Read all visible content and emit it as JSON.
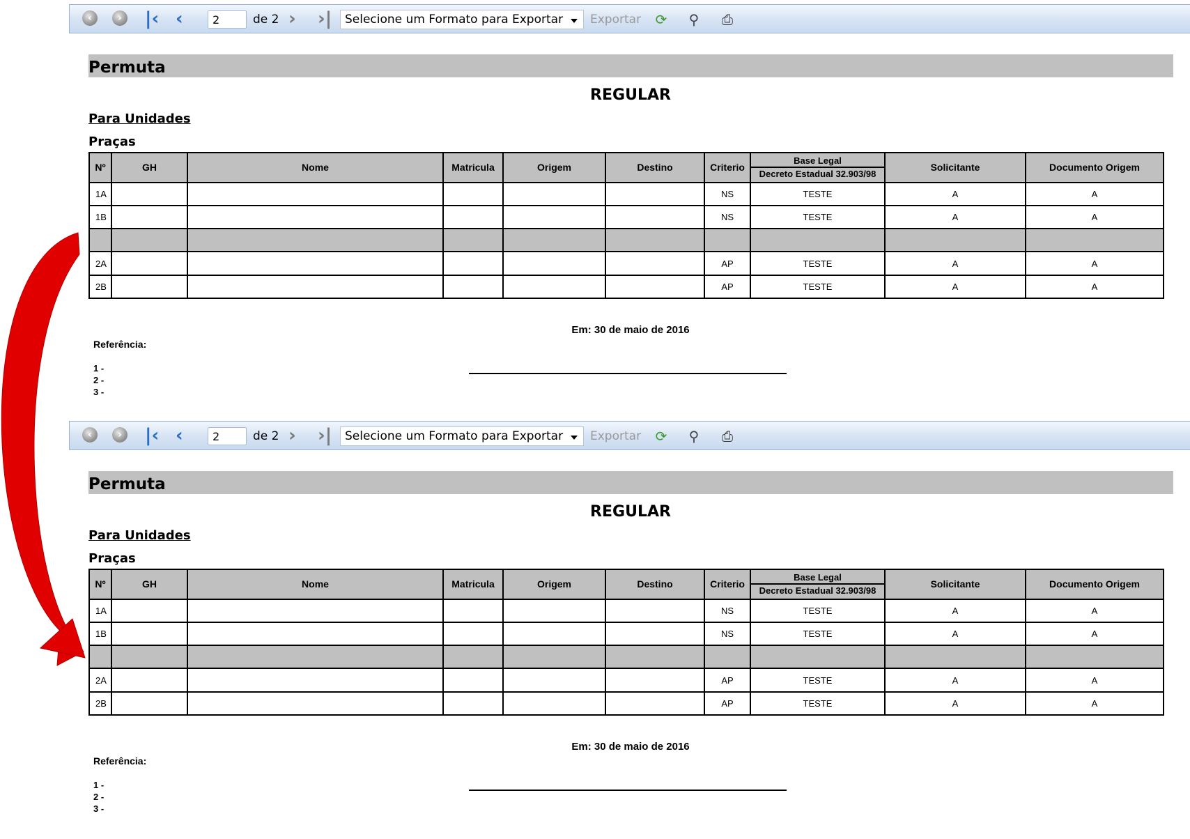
{
  "panels": [
    {
      "toolbar": {
        "page_value": "2",
        "of_label": "de 2",
        "export_format_selected": "Selecione um Formato para Exportar",
        "export_label": "Exportar"
      },
      "report": {
        "title": "Permuta",
        "heading": "REGULAR",
        "section_label": "Para Unidades",
        "subsection_label": "Praças",
        "columns": {
          "n": "Nº",
          "gh": "GH",
          "nome": "Nome",
          "matricula": "Matricula",
          "origem": "Origem",
          "destino": "Destino",
          "criterio": "Criterio",
          "base_legal": "Base Legal",
          "base_legal_sub": "Decreto Estadual 32.903/98",
          "solicitante": "Solicitante",
          "documento_origem": "Documento Origem"
        },
        "rows": [
          {
            "n": "1A",
            "criterio": "NS",
            "base_legal": "TESTE",
            "solicitante": "A",
            "documento_origem": "A"
          },
          {
            "n": "1B",
            "criterio": "NS",
            "base_legal": "TESTE",
            "solicitante": "A",
            "documento_origem": "A"
          },
          {
            "n": "2A",
            "criterio": "AP",
            "base_legal": "TESTE",
            "solicitante": "A",
            "documento_origem": "A"
          },
          {
            "n": "2B",
            "criterio": "AP",
            "base_legal": "TESTE",
            "solicitante": "A",
            "documento_origem": "A"
          }
        ],
        "date_line": "Em: 30 de maio de 2016",
        "reference_label": "Referência:",
        "reference_items": [
          "1 -",
          "2 -",
          "3 -"
        ]
      }
    },
    {
      "toolbar": {
        "page_value": "2",
        "of_label": "de 2",
        "export_format_selected": "Selecione um Formato para Exportar",
        "export_label": "Exportar"
      },
      "report": {
        "title": "Permuta",
        "heading": "REGULAR",
        "section_label": "Para Unidades",
        "subsection_label": "Praças",
        "columns": {
          "n": "Nº",
          "gh": "GH",
          "nome": "Nome",
          "matricula": "Matricula",
          "origem": "Origem",
          "destino": "Destino",
          "criterio": "Criterio",
          "base_legal": "Base Legal",
          "base_legal_sub": "Decreto Estadual 32.903/98",
          "solicitante": "Solicitante",
          "documento_origem": "Documento Origem"
        },
        "rows": [
          {
            "n": "1A",
            "criterio": "NS",
            "base_legal": "TESTE",
            "solicitante": "A",
            "documento_origem": "A"
          },
          {
            "n": "1B",
            "criterio": "NS",
            "base_legal": "TESTE",
            "solicitante": "A",
            "documento_origem": "A"
          },
          {
            "n": "2A",
            "criterio": "AP",
            "base_legal": "TESTE",
            "solicitante": "A",
            "documento_origem": "A"
          },
          {
            "n": "2B",
            "criterio": "AP",
            "base_legal": "TESTE",
            "solicitante": "A",
            "documento_origem": "A"
          }
        ],
        "date_line": "Em: 30 de maio de 2016",
        "reference_label": "Referência:",
        "reference_items": [
          "1 -",
          "2 -",
          "3 -"
        ]
      }
    }
  ],
  "colors": {
    "accent_blue": "#2b6ec8",
    "header_gray": "#c0c0c0",
    "arrow_red": "#e00000"
  }
}
